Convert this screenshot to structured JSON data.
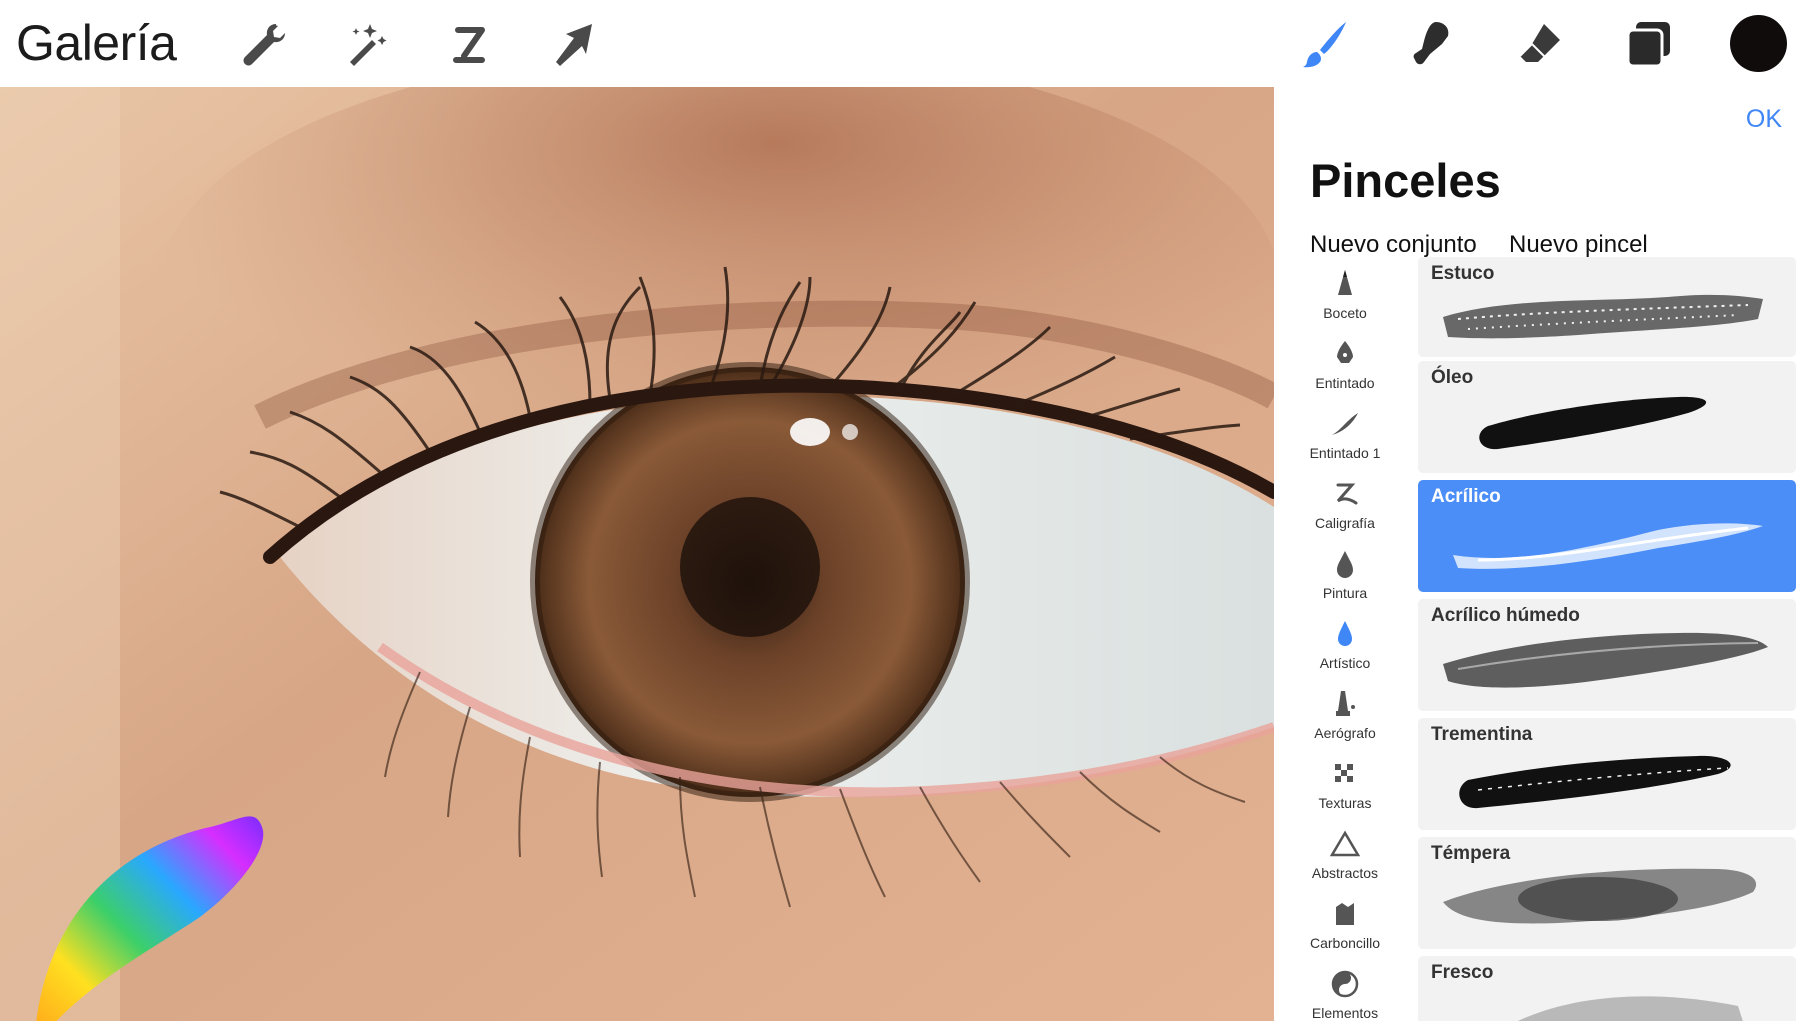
{
  "app": {
    "title": "Galería"
  },
  "toolbar": {
    "left_tools": [
      "wrench-icon",
      "magic-wand-icon",
      "selection-icon",
      "move-arrow-icon"
    ],
    "right_tools": [
      "brush-icon",
      "smudge-icon",
      "eraser-icon",
      "layers-icon"
    ],
    "active_tool": "brush-icon",
    "accent_color": "#3f86f6",
    "current_color": "#0f0c0b"
  },
  "panel": {
    "ok_label": "OK",
    "title": "Pinceles",
    "new_set_label": "Nuevo conjunto",
    "new_brush_label": "Nuevo pincel",
    "categories": [
      {
        "label": "Boceto",
        "icon": "pencil-tip-icon"
      },
      {
        "label": "Entintado",
        "icon": "pen-nib-icon"
      },
      {
        "label": "Entintado 1",
        "icon": "stroke-icon"
      },
      {
        "label": "Caligrafía",
        "icon": "calligraphy-icon"
      },
      {
        "label": "Pintura",
        "icon": "paint-drop-icon"
      },
      {
        "label": "Artístico",
        "icon": "blue-drop-icon"
      },
      {
        "label": "Aerógrafo",
        "icon": "airbrush-icon"
      },
      {
        "label": "Texturas",
        "icon": "checker-icon"
      },
      {
        "label": "Abstractos",
        "icon": "triangle-icon"
      },
      {
        "label": "Carboncillo",
        "icon": "charcoal-icon"
      },
      {
        "label": "Elementos",
        "icon": "yin-yang-icon"
      }
    ],
    "brushes": [
      {
        "name": "Estuco",
        "selected": false
      },
      {
        "name": "Óleo",
        "selected": false
      },
      {
        "name": "Acrílico",
        "selected": true
      },
      {
        "name": "Acrílico húmedo",
        "selected": false
      },
      {
        "name": "Trementina",
        "selected": false
      },
      {
        "name": "Témpera",
        "selected": false
      },
      {
        "name": "Fresco",
        "selected": false
      }
    ],
    "selected_color": "#4b8ef7"
  }
}
